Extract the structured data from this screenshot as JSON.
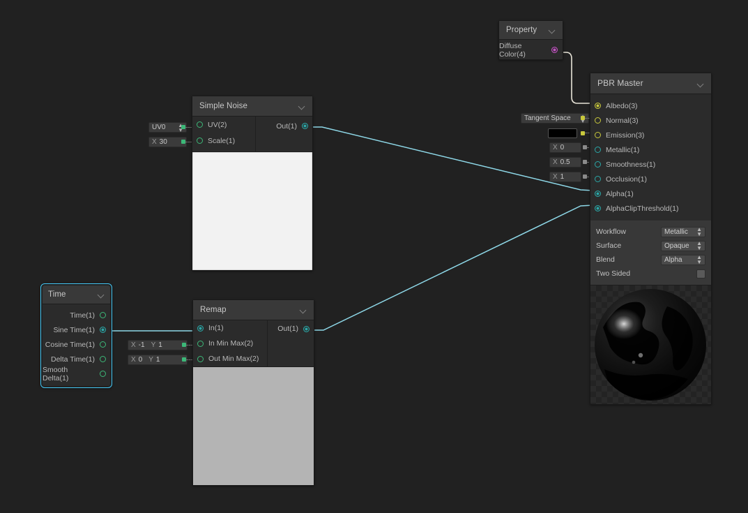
{
  "canvas": {
    "background": "#212121"
  },
  "property_node": {
    "header": "Property",
    "items": [
      {
        "label": "Diffuse Color(4)",
        "port_color": "#c452c4"
      }
    ]
  },
  "pbr_master": {
    "header": "PBR Master",
    "inputs": [
      {
        "label": "Albedo(3)",
        "port_color": "#c8c83c",
        "connected": true,
        "field": null
      },
      {
        "label": "Normal(3)",
        "port_color": "#c8c83c",
        "connected": false,
        "field": {
          "type": "enum",
          "value": "Tangent Space"
        }
      },
      {
        "label": "Emission(3)",
        "port_color": "#c8c83c",
        "connected": false,
        "field": {
          "type": "color",
          "value": "#000000"
        }
      },
      {
        "label": "Metallic(1)",
        "port_color": "#2aa7a7",
        "connected": false,
        "field": {
          "type": "float",
          "axis": "X",
          "value": "0"
        }
      },
      {
        "label": "Smoothness(1)",
        "port_color": "#2aa7a7",
        "connected": false,
        "field": {
          "type": "float",
          "axis": "X",
          "value": "0.5"
        }
      },
      {
        "label": "Occlusion(1)",
        "port_color": "#2aa7a7",
        "connected": false,
        "field": {
          "type": "float",
          "axis": "X",
          "value": "1"
        }
      },
      {
        "label": "Alpha(1)",
        "port_color": "#2aa7a7",
        "connected": true,
        "field": null
      },
      {
        "label": "AlphaClipThreshold(1)",
        "port_color": "#2aa7a7",
        "connected": true,
        "field": null
      }
    ],
    "settings": [
      {
        "name": "Workflow",
        "type": "enum",
        "value": "Metallic"
      },
      {
        "name": "Surface",
        "type": "enum",
        "value": "Opaque"
      },
      {
        "name": "Blend",
        "type": "enum",
        "value": "Alpha"
      },
      {
        "name": "Two Sided",
        "type": "checkbox",
        "value": ""
      }
    ]
  },
  "simple_noise": {
    "header": "Simple Noise",
    "inputs": [
      {
        "label": "UV(2)",
        "port_color": "#3cb878",
        "field": {
          "type": "enum",
          "value": "UV0"
        }
      },
      {
        "label": "Scale(1)",
        "port_color": "#3cb878",
        "field": {
          "type": "float",
          "axis": "X",
          "value": "30"
        }
      }
    ],
    "outputs": [
      {
        "label": "Out(1)",
        "port_color": "#2aa7a7",
        "connected": true
      }
    ],
    "preview": "noise"
  },
  "time_node": {
    "header": "Time",
    "selected": true,
    "outputs": [
      {
        "label": "Time(1)",
        "port_color": "#3cb878",
        "connected": false
      },
      {
        "label": "Sine Time(1)",
        "port_color": "#2aa7a7",
        "connected": true
      },
      {
        "label": "Cosine Time(1)",
        "port_color": "#3cb878",
        "connected": false
      },
      {
        "label": "Delta Time(1)",
        "port_color": "#3cb878",
        "connected": false
      },
      {
        "label": "Smooth Delta(1)",
        "port_color": "#3cb878",
        "connected": false
      }
    ]
  },
  "remap_node": {
    "header": "Remap",
    "inputs": [
      {
        "label": "In(1)",
        "port_color": "#2aa7a7",
        "connected": true,
        "field": null
      },
      {
        "label": "In Min Max(2)",
        "port_color": "#3cb878",
        "connected": false,
        "field": {
          "type": "vec2",
          "x_axis": "X",
          "x_value": "-1",
          "y_axis": "Y",
          "y_value": "1"
        }
      },
      {
        "label": "Out Min Max(2)",
        "port_color": "#3cb878",
        "connected": false,
        "field": {
          "type": "vec2",
          "x_axis": "X",
          "x_value": "0",
          "y_axis": "Y",
          "y_value": "1"
        }
      }
    ],
    "outputs": [
      {
        "label": "Out(1)",
        "port_color": "#2aa7a7",
        "connected": true
      }
    ],
    "preview": "flat"
  },
  "wire_colors": {
    "data": "#8ed8e8",
    "color_property": "#e8e4d8",
    "albedo": "#c8c83c"
  }
}
